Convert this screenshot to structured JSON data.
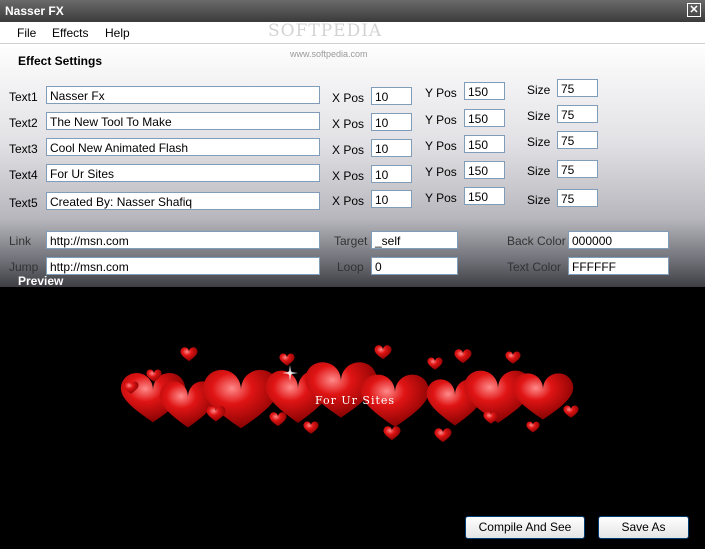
{
  "window": {
    "title": "Nasser FX",
    "close_glyph": "✕"
  },
  "watermark": {
    "text": "SOFTPEDIA",
    "url": "www.softpedia.com"
  },
  "menu": {
    "items": [
      "File",
      "Effects",
      "Help"
    ]
  },
  "settings": {
    "title": "Effect Settings",
    "xpos_label": "X Pos",
    "ypos_label": "Y Pos",
    "size_label": "Size",
    "rows": [
      {
        "label": "Text1",
        "value": "Nasser Fx",
        "xpos": "10",
        "ypos": "150",
        "size": "75"
      },
      {
        "label": "Text2",
        "value": "The New Tool To Make",
        "xpos": "10",
        "ypos": "150",
        "size": "75"
      },
      {
        "label": "Text3",
        "value": "Cool New Animated Flash",
        "xpos": "10",
        "ypos": "150",
        "size": "75"
      },
      {
        "label": "Text4",
        "value": "For Ur Sites",
        "xpos": "10",
        "ypos": "150",
        "size": "75"
      },
      {
        "label": "Text5",
        "value": "Created By: Nasser Shafiq",
        "xpos": "10",
        "ypos": "150",
        "size": "75"
      }
    ],
    "link": {
      "label": "Link",
      "value": "http://msn.com"
    },
    "jump": {
      "label": "Jump",
      "value": "http://msn.com"
    },
    "target": {
      "label": "Target",
      "value": "_self"
    },
    "loop": {
      "label": "Loop",
      "value": "0"
    },
    "back_color": {
      "label": "Back Color",
      "value": "000000"
    },
    "text_color": {
      "label": "Text Color",
      "value": "FFFFFF"
    }
  },
  "preview": {
    "title": "Preview",
    "text": "For Ur Sites"
  },
  "buttons": {
    "compile": "Compile And See",
    "save_as": "Save As"
  },
  "colors": {
    "heart": "#d40000",
    "preview_bg": "#000000",
    "button_border": "#003c74"
  }
}
